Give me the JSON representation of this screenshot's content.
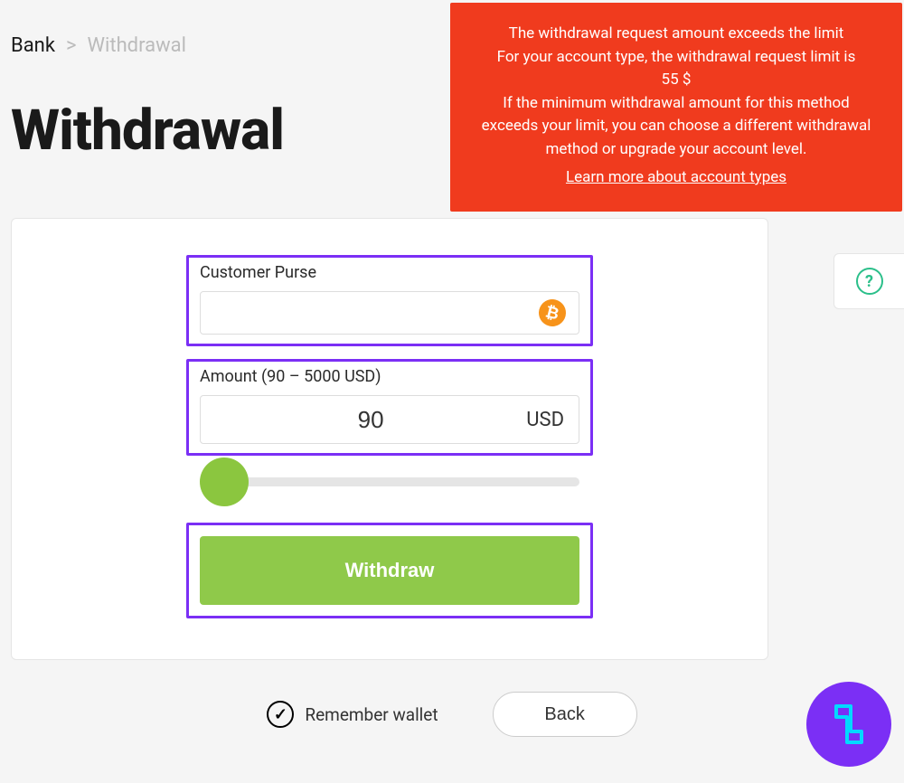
{
  "breadcrumb": {
    "root": "Bank",
    "separator": ">",
    "current": "Withdrawal"
  },
  "page": {
    "title": "Withdrawal"
  },
  "alert": {
    "line1": "The withdrawal request amount exceeds the limit",
    "line2": "For your account type, the withdrawal request limit is",
    "line3": "55 $",
    "line4": "If the minimum withdrawal amount for this method exceeds your limit, you can choose a different withdrawal method or upgrade your account level.",
    "link": "Learn more about account types"
  },
  "form": {
    "purse_label": "Customer Purse",
    "purse_value": "",
    "btc_glyph": "₿",
    "amount_label": "Amount (90 – 5000 USD)",
    "amount_value": "90",
    "amount_currency": "USD",
    "withdraw_label": "Withdraw"
  },
  "footer": {
    "remember_label": "Remember wallet",
    "remember_checked": true,
    "check_glyph": "✓",
    "back_label": "Back"
  },
  "help": {
    "glyph": "?"
  }
}
